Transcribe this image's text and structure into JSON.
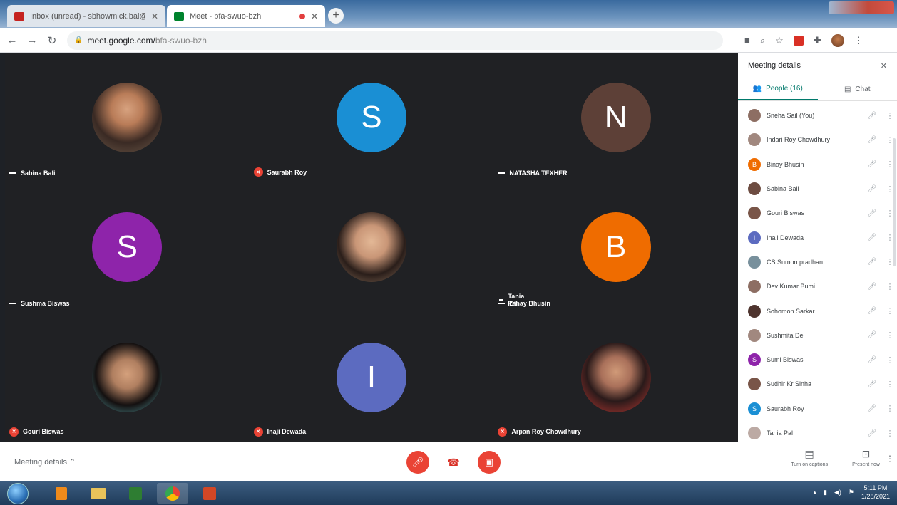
{
  "browser": {
    "tabs": [
      {
        "title": "Inbox (unread) - sbhowmick.bal@gmail.com",
        "favicon_color": "#c5221f"
      },
      {
        "title": "Meet - bfa-swuo-bzh",
        "favicon_color": "#00832d",
        "recording": true
      }
    ],
    "new_tab_label": "+",
    "url_host": "meet.google.com/",
    "url_path": "bfa-swuo-bzh"
  },
  "tiles": [
    {
      "name": "Sabina Bali",
      "avatar_letter": "",
      "avatar_type": "photo",
      "muted": false
    },
    {
      "name": "Saurabh Roy",
      "avatar_letter": "S",
      "avatar_color": "#1a8fd4",
      "muted": true
    },
    {
      "name": "NATASHA TEXHER",
      "avatar_letter": "N",
      "avatar_color": "#5d4037",
      "muted": false
    },
    {
      "name": "Sushma Biswas",
      "avatar_letter": "S",
      "avatar_color": "#8e24aa",
      "muted": false
    },
    {
      "name": "Tania Pal",
      "avatar_letter": "",
      "avatar_type": "photo2",
      "muted": false
    },
    {
      "name": "Binay Bhusin",
      "avatar_letter": "B",
      "avatar_color": "#ef6c00",
      "muted": false
    },
    {
      "name": "Gouri Biswas",
      "avatar_letter": "",
      "avatar_type": "photo3",
      "muted": true
    },
    {
      "name": "Inaji Dewada",
      "avatar_letter": "I",
      "avatar_color": "#5c6bc0",
      "muted": true
    },
    {
      "name": "Arpan Roy Chowdhury",
      "avatar_letter": "",
      "avatar_type": "photo4",
      "muted": true
    }
  ],
  "panel": {
    "title": "Meeting details",
    "close_label": "✕",
    "tab_people": "People (16)",
    "tab_chat": "Chat",
    "participants": [
      {
        "name": "Sneha Sail (You)",
        "color": "#8d6e63",
        "letter": ""
      },
      {
        "name": "Indari Roy Chowdhury",
        "color": "#a1887f",
        "letter": ""
      },
      {
        "name": "Binay Bhusin",
        "color": "#ef6c00",
        "letter": "B"
      },
      {
        "name": "Sabina Bali",
        "color": "#6d4c41",
        "letter": ""
      },
      {
        "name": "Gouri Biswas",
        "color": "#795548",
        "letter": ""
      },
      {
        "name": "Inaji Dewada",
        "color": "#5c6bc0",
        "letter": "I"
      },
      {
        "name": "CS Sumon pradhan",
        "color": "#78909c",
        "letter": ""
      },
      {
        "name": "Dev Kumar Bumi",
        "color": "#8d6e63",
        "letter": ""
      },
      {
        "name": "Sohomon Sarkar",
        "color": "#4e342e",
        "letter": ""
      },
      {
        "name": "Sushmita De",
        "color": "#a1887f",
        "letter": ""
      },
      {
        "name": "Sumi Biswas",
        "color": "#8e24aa",
        "letter": "S"
      },
      {
        "name": "Sudhir Kr Sinha",
        "color": "#795548",
        "letter": ""
      },
      {
        "name": "Saurabh Roy",
        "color": "#1a8fd4",
        "letter": "S"
      },
      {
        "name": "Tania Pal",
        "color": "#bcaaa4",
        "letter": ""
      }
    ]
  },
  "bottombar": {
    "meeting_details_label": "Meeting details ⌃",
    "turn_on_captions": "Turn on captions",
    "present_now": "Present now"
  },
  "taskbar": {
    "time": "5:11 PM",
    "date": "1/28/2021"
  }
}
